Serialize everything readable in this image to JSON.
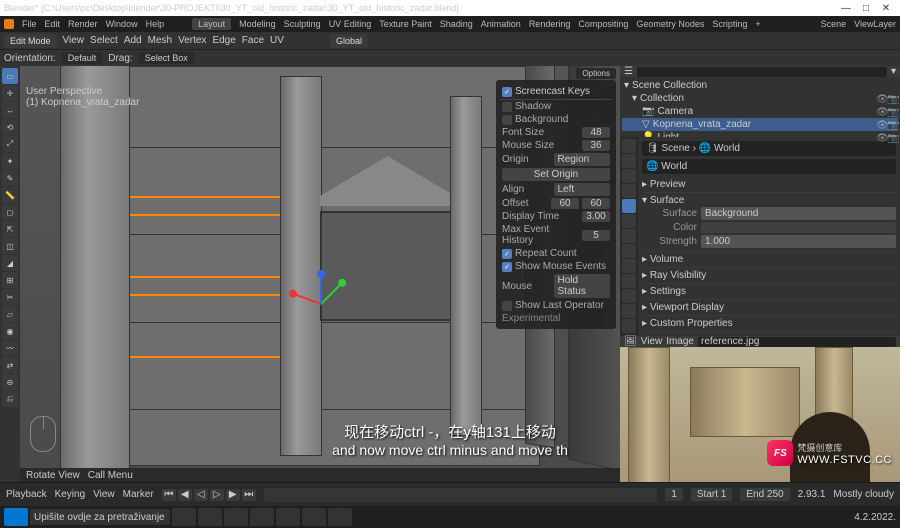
{
  "window": {
    "title": "Blender* [C:\\Users\\pc\\Desktop\\blender\\30-PROJEKTI\\30_YT_old_historic_zadar\\30_YT_old_historic_zadar.blend]",
    "min": "—",
    "max": "□",
    "close": "✕"
  },
  "menus": {
    "file": "File",
    "edit": "Edit",
    "render": "Render",
    "window": "Window",
    "help": "Help"
  },
  "workspaces": {
    "layout": "Layout",
    "modeling": "Modeling",
    "sculpting": "Sculpting",
    "uv": "UV Editing",
    "tex": "Texture Paint",
    "shading": "Shading",
    "anim": "Animation",
    "rendering": "Rendering",
    "comp": "Compositing",
    "geo": "Geometry Nodes",
    "script": "Scripting",
    "plus": "+"
  },
  "topright": {
    "scene_lbl": "Scene",
    "scene": "Scene",
    "layer_lbl": "ViewLayer",
    "layer": "ViewLayer"
  },
  "modebar": {
    "mode": "Edit Mode",
    "view": "View",
    "select": "Select",
    "add": "Add",
    "mesh": "Mesh",
    "vertex": "Vertex",
    "edge": "Edge",
    "face": "Face",
    "uv": "UV",
    "global": "Global"
  },
  "secondbar": {
    "orientation": "Orientation:",
    "default": "Default",
    "drag": "Drag:",
    "selectbox": "Select Box"
  },
  "viewport": {
    "persp": "User Perspective",
    "obj": "(1) Kopnena_vrata_zadar",
    "options": "Options"
  },
  "screencast": {
    "title": "Screencast Keys",
    "rows": {
      "shadow": "Shadow",
      "background": "Background",
      "fontsize": "Font Size",
      "fontsize_v": "48",
      "mousesize": "Mouse Size",
      "mousesize_v": "36",
      "origin": "Origin",
      "origin_v": "Region",
      "setorigin": "Set Origin",
      "align": "Align",
      "align_v": "Left",
      "offset": "Offset",
      "offx": "60",
      "offy": "60",
      "displaytime": "Display Time",
      "displaytime_v": "3.00",
      "maxhist": "Max Event History",
      "maxhist_v": "5",
      "repeat": "Repeat Count",
      "showmouse": "Show Mouse Events",
      "mouse": "Mouse",
      "mouse_v": "Hold Status",
      "showlast": "Show Last Operator",
      "experimental": "Experimental"
    }
  },
  "outliner": {
    "root": "Scene Collection",
    "collection": "Collection",
    "camera": "Camera",
    "obj": "Kopnena_vrata_zadar",
    "light": "Light"
  },
  "properties": {
    "breadcrumb_scene": "Scene",
    "breadcrumb_world": "World",
    "world": "World",
    "preview": "Preview",
    "surface": "Surface",
    "surface_v": "Background",
    "color": "Color",
    "strength": "Strength",
    "strength_v": "1.000",
    "volume": "Volume",
    "rayvis": "Ray Visibility",
    "settings": "Settings",
    "viewport": "Viewport Display",
    "custom": "Custom Properties"
  },
  "refname": "reference.jpg",
  "timeline": {
    "playback": "Playback",
    "keying": "Keying",
    "view": "View",
    "marker": "Marker",
    "frame": "1",
    "start_lbl": "Start",
    "start": "1",
    "end_lbl": "End",
    "end": "250"
  },
  "statusbar": {
    "hint": "Upišite ovdje za pretraživanje",
    "rotate": "Rotate View",
    "menu": "Call Menu",
    "version": "2.93.1",
    "stats": "Mostly cloudy",
    "date": "4.2.2022."
  },
  "subtitle": {
    "cn": "现在移动ctrl -，在y轴131上移动",
    "en": "and now move ctrl minus and move th"
  },
  "watermark": {
    "logo": "FS",
    "text": "梵摄创意库",
    "url": "WWW.FSTVC.CC"
  }
}
